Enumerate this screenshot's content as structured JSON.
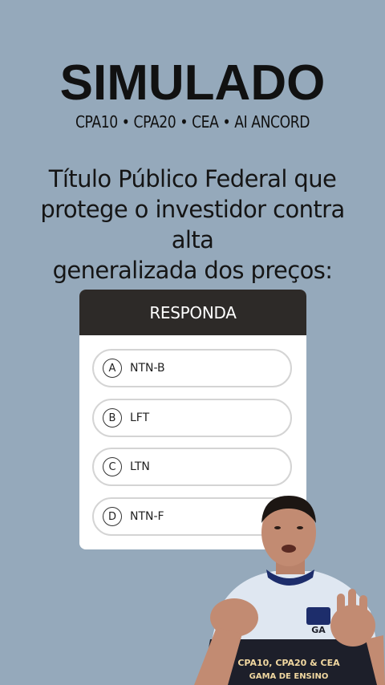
{
  "header": {
    "title": "SIMULADO",
    "subtitle": "CPA10 • CPA20 • CEA • AI ANCORD"
  },
  "question": {
    "line1": "Título Público Federal que",
    "line2": "protege o investidor contra alta",
    "line3": "generalizada dos preços:"
  },
  "card": {
    "header": "RESPONDA",
    "options": [
      {
        "letter": "A",
        "label": "NTN-B"
      },
      {
        "letter": "B",
        "label": "LFT"
      },
      {
        "letter": "C",
        "label": "LTN"
      },
      {
        "letter": "D",
        "label": "NTN-F"
      }
    ]
  },
  "presenter": {
    "shirt_text_line1": "CPA10, CPA20 & CEA",
    "shirt_text_line2": "GAMA DE ENSINO",
    "logo_text": "GA"
  },
  "colors": {
    "background": "#95a9bb",
    "card_header": "#2d2a28",
    "shirt": "#1d1f2a"
  }
}
